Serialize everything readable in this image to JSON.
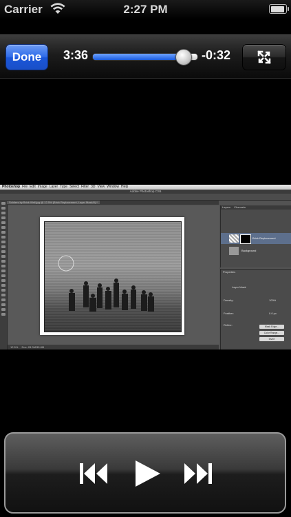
{
  "status_bar": {
    "carrier": "Carrier",
    "time": "2:27 PM",
    "icons": [
      "wifi-icon",
      "battery-icon"
    ],
    "battery_level": 0.92
  },
  "player": {
    "done_label": "Done",
    "elapsed": "3:36",
    "remaining": "-0:32",
    "progress": 0.87,
    "fullscreen_icon": "fullscreen-toggle-icon",
    "colors": {
      "accent": "#2f6ce9",
      "done_border": "#0d2c78"
    }
  },
  "video_frame": {
    "menu": [
      "Photoshop",
      "File",
      "Edit",
      "Image",
      "Layer",
      "Type",
      "Select",
      "Filter",
      "3D",
      "View",
      "Window",
      "Help"
    ],
    "title": "Adobe Photoshop CS6",
    "doc_tab": "Soldiers by Brick Wall.jpg @ 12.5% (Brick Replacement, Layer Mask/8) *",
    "status": "Doc: 28.3M/35.8M",
    "zoom": "12.5%",
    "panel_tabs": [
      "Layers",
      "Channels"
    ],
    "layers": [
      "Brick Replacement",
      "Background"
    ],
    "properties": {
      "title": "Properties",
      "mask_label": "Layer Mask",
      "density_label": "Density:",
      "density_value": "100%",
      "feather_label": "Feather:",
      "feather_value": "0.0 px",
      "refine_label": "Refine:",
      "buttons": [
        "Mask Edge...",
        "Color Range...",
        "Invert"
      ]
    }
  },
  "transport": {
    "icons": [
      "previous-track-icon",
      "play-icon",
      "next-track-icon"
    ]
  }
}
